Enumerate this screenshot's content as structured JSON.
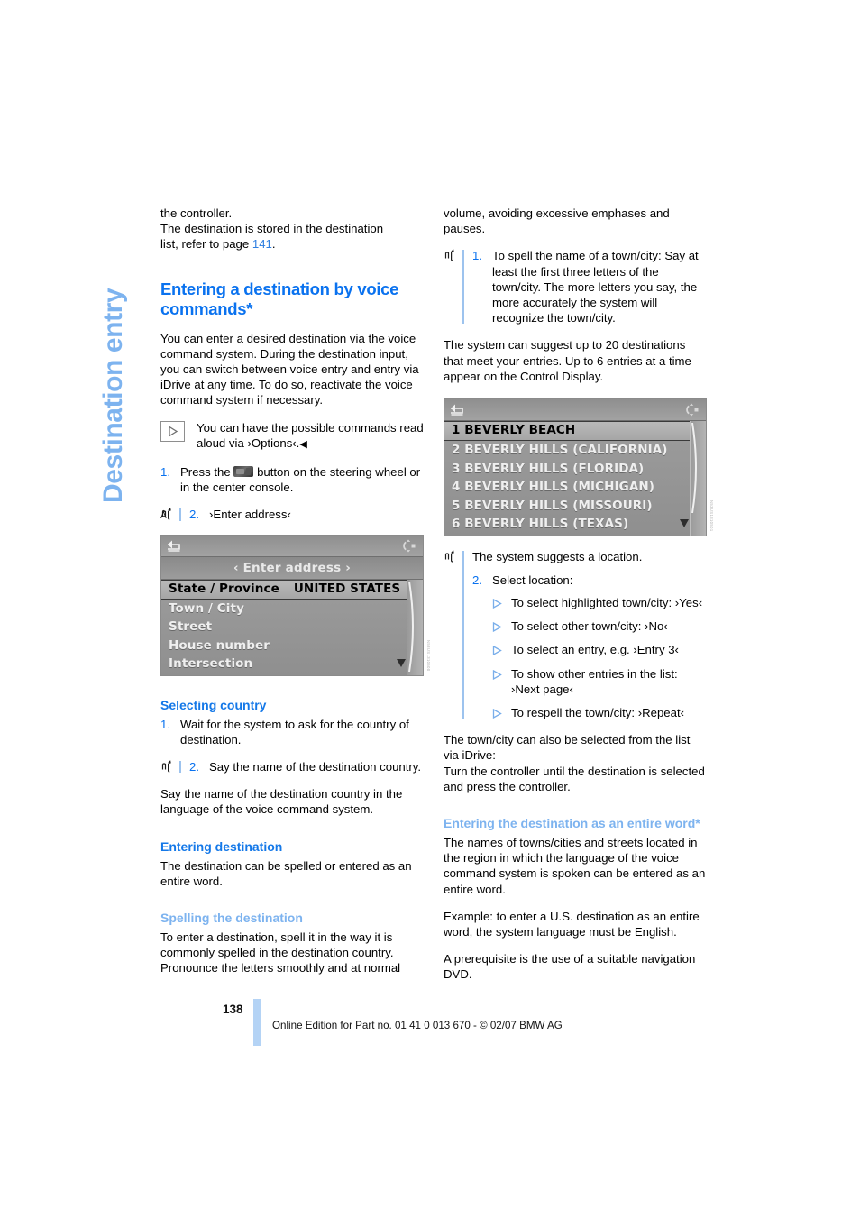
{
  "chapter_tab": "Destination entry",
  "left_column": {
    "intro_lines": [
      "the controller.",
      "The destination is stored in the destination",
      "list, refer to page "
    ],
    "intro_page_ref": "141",
    "intro_trailing": ".",
    "heading_main": "Entering a destination by voice commands*",
    "para_1": "You can enter a desired destination via the voice command system. During the destination input, you can switch between voice entry and entry via iDrive at any time. To do so, reactivate the voice command system if necessary.",
    "note": {
      "icon": "play-triangle-icon",
      "text": "You can have the possible commands read aloud via ›Options‹.",
      "end_mark": "◀"
    },
    "steps_1": [
      {
        "num": "1.",
        "text_before": "Press the",
        "inline_icon": "steering-wheel-voice-button-icon",
        "text_after": "button on the steering wheel or in the center console.",
        "voice": false
      },
      {
        "num": "2.",
        "text": "›Enter address‹",
        "voice": true
      }
    ],
    "screenshot_1": {
      "name": "enter-address-display",
      "back_icon": "back-arrow-icon",
      "controller_icon": "idrive-controller-icon",
      "title": "‹ Enter address ›",
      "rows": [
        {
          "label": "State / Province",
          "value": "UNITED STATES",
          "selected": true
        },
        {
          "label": "Town / City",
          "value": "",
          "selected": false
        },
        {
          "label": "Street",
          "value": "",
          "selected": false
        },
        {
          "label": "House number",
          "value": "",
          "selected": false
        },
        {
          "label": "Intersection",
          "value": "",
          "selected": false
        }
      ],
      "image_code": "N53US1310500"
    },
    "heading_selecting_country": "Selecting country",
    "steps_country": [
      {
        "num": "1.",
        "text": "Wait for the system to ask for the country of destination.",
        "voice": false
      },
      {
        "num": "2.",
        "text": "Say the name of the destination country.",
        "voice": true
      }
    ],
    "para_country": "Say the name of the destination country in the language of the voice command system.",
    "heading_entering_destination": "Entering destination",
    "para_entering_destination": "The destination can be spelled or entered as an entire word.",
    "heading_spelling": "Spelling the destination",
    "para_spelling": "To enter a destination, spell it in the way it is commonly spelled in the destination country. Pronounce the letters smoothly and at normal"
  },
  "right_column": {
    "para_continued": "volume, avoiding excessive emphases and pauses.",
    "step_spell": {
      "num": "1.",
      "text": "To spell the name of a town/city: Say at least the first three letters of the town/city. The more letters you say, the more accurately the system will recognize the town/city.",
      "voice": true
    },
    "para_suggest": "The system can suggest up to 20 destinations that meet your entries. Up to 6 entries at a time appear on the Control Display.",
    "screenshot_2": {
      "name": "town-city-suggestion-list-display",
      "back_icon": "back-arrow-icon",
      "controller_icon": "idrive-controller-icon",
      "rows": [
        {
          "label": "1 BEVERLY BEACH",
          "selected": true
        },
        {
          "label": "2 BEVERLY HILLS (CALIFORNIA)",
          "selected": false
        },
        {
          "label": "3 BEVERLY HILLS (FLORIDA)",
          "selected": false
        },
        {
          "label": "4 BEVERLY HILLS (MICHIGAN)",
          "selected": false
        },
        {
          "label": "5 BEVERLY HILLS (MISSOURI)",
          "selected": false
        },
        {
          "label": "6 BEVERLY HILLS (TEXAS)",
          "selected": false
        }
      ],
      "image_code": "N53US1310501"
    },
    "suggest_line": "The system suggests a location.",
    "step_select": {
      "num": "2.",
      "text": "Select location:"
    },
    "select_options": [
      "To select highlighted town/city: ›Yes‹",
      "To select other town/city: ›No‹",
      "To select an entry, e.g. ›Entry 3‹",
      "To show other entries in the list: ›Next page‹",
      "To respell the town/city: ›Repeat‹"
    ],
    "para_idrive": "The town/city can also be selected from the list via iDrive:\nTurn the controller until the destination is selected and press the controller.",
    "heading_entire_word": "Entering the destination as an entire word*",
    "para_entire_1": "The names of towns/cities and streets located in the region in which the language of the voice command system is spoken can be entered as an entire word.",
    "para_entire_2": "Example: to enter a U.S. destination as an entire word, the system language must be English.",
    "para_entire_3": "A prerequisite is the use of a suitable navigation DVD."
  },
  "footer": {
    "page_number": "138",
    "credit": "Online Edition for Part no. 01 41 0 013 670 - © 02/07 BMW AG"
  },
  "colors": {
    "heading_blue": "#0a72ef",
    "sub_heading_blue": "#1478e8",
    "light_blue": "#7db3ef",
    "footer_bar": "#b4d3f5"
  }
}
